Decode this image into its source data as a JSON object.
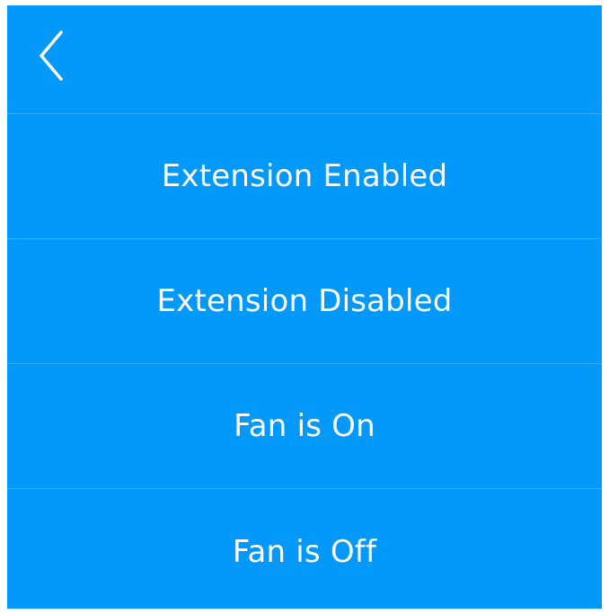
{
  "theme": {
    "background": "#0299fa",
    "text": "#ffffff",
    "divider": "#34aefb"
  },
  "header": {
    "back_icon": "chevron-left-icon"
  },
  "menu": {
    "items": [
      {
        "label": "Extension Enabled"
      },
      {
        "label": "Extension Disabled"
      },
      {
        "label": "Fan is On"
      },
      {
        "label": "Fan is Off"
      }
    ]
  }
}
